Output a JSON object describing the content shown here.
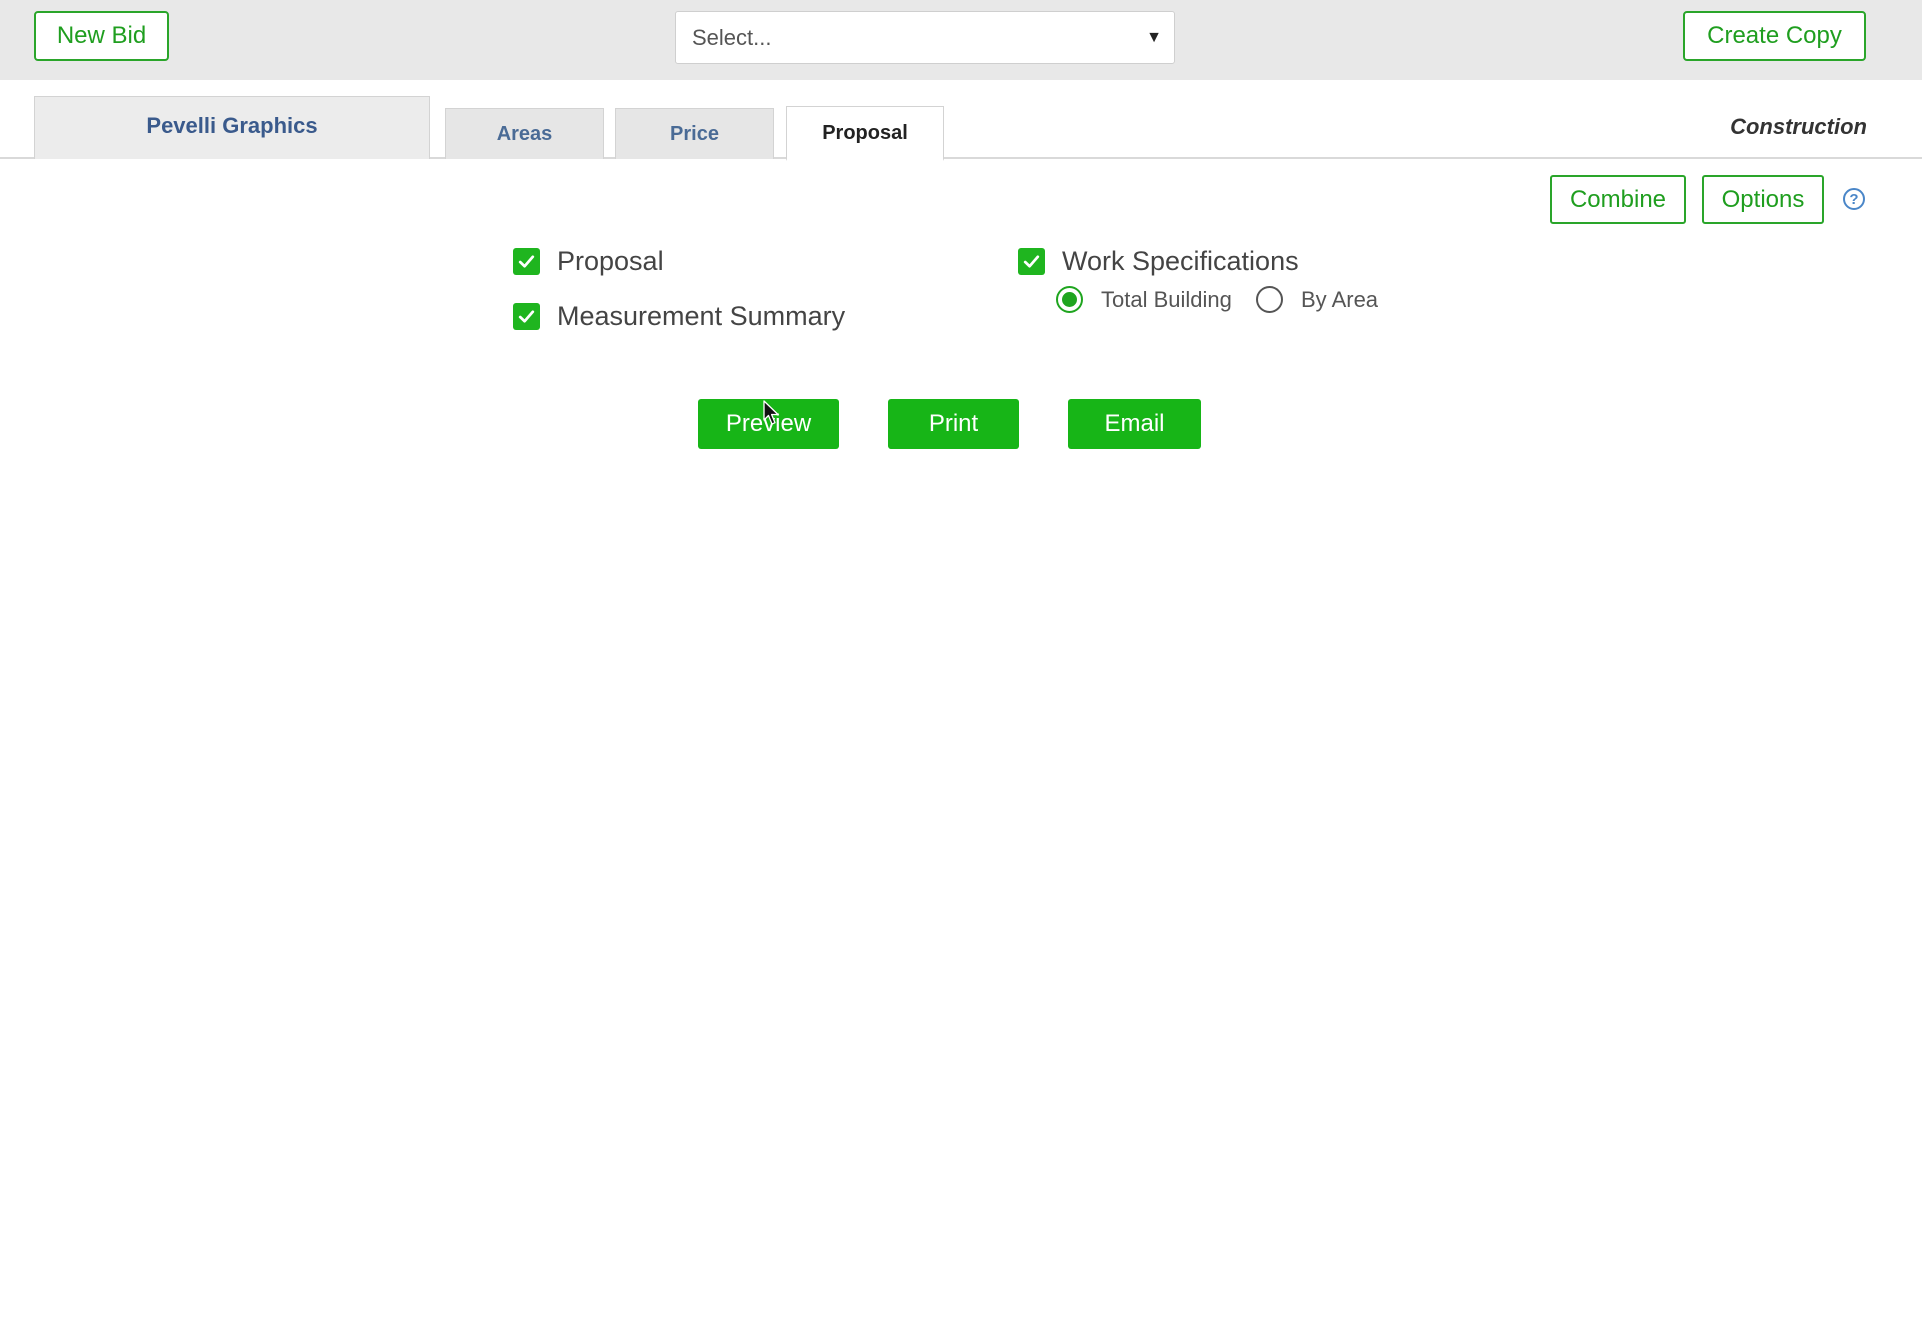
{
  "toolbar": {
    "new_bid_label": "New Bid",
    "select_placeholder": "Select...",
    "create_copy_label": "Create Copy"
  },
  "tabs": {
    "company": "Pevelli Graphics",
    "items": [
      {
        "label": "Areas"
      },
      {
        "label": "Price"
      },
      {
        "label": "Proposal"
      }
    ],
    "active": "Proposal",
    "context_label": "Construction"
  },
  "actions": {
    "combine_label": "Combine",
    "options_label": "Options",
    "help_glyph": "?"
  },
  "options": {
    "proposal": {
      "label": "Proposal",
      "checked": true
    },
    "measurement_summary": {
      "label": "Measurement Summary",
      "checked": true
    },
    "work_specifications": {
      "label": "Work Specifications",
      "checked": true
    },
    "scope": {
      "selected": "Total Building",
      "choices": [
        "Total Building",
        "By Area"
      ]
    }
  },
  "buttons": {
    "preview": "Preview",
    "print": "Print",
    "email": "Email"
  },
  "colors": {
    "accent_green": "#17b517",
    "outline_green": "#2aa52a",
    "tab_text_blue": "#4a6b96"
  }
}
